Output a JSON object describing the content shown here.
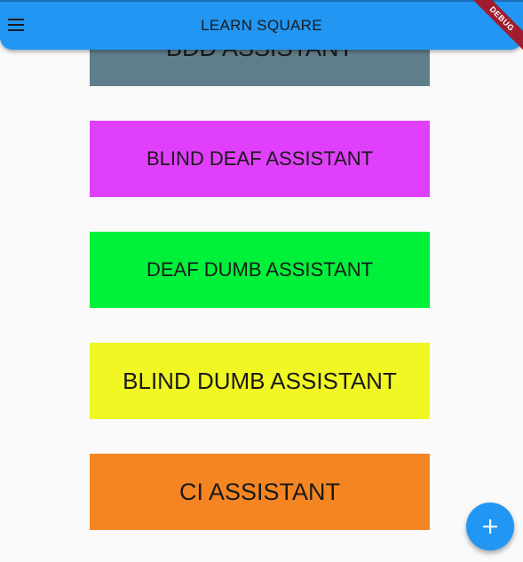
{
  "app_bar": {
    "title": "LEARN SQUARE",
    "menu_icon": "hamburger-menu-icon",
    "debug_banner": "DEBUG",
    "color": "#2196f3"
  },
  "cards": [
    {
      "label": "BDD ASSISTANT",
      "color": "#607d8b"
    },
    {
      "label": "BLIND DEAF ASSISTANT",
      "color": "#e040fb"
    },
    {
      "label": "DEAF DUMB ASSISTANT",
      "color": "#00f13a"
    },
    {
      "label": "BLIND DUMB ASSISTANT",
      "color": "#f1f723"
    },
    {
      "label": "CI ASSISTANT",
      "color": "#f58523"
    }
  ],
  "fab": {
    "icon": "add-icon",
    "color": "#2196f3"
  }
}
